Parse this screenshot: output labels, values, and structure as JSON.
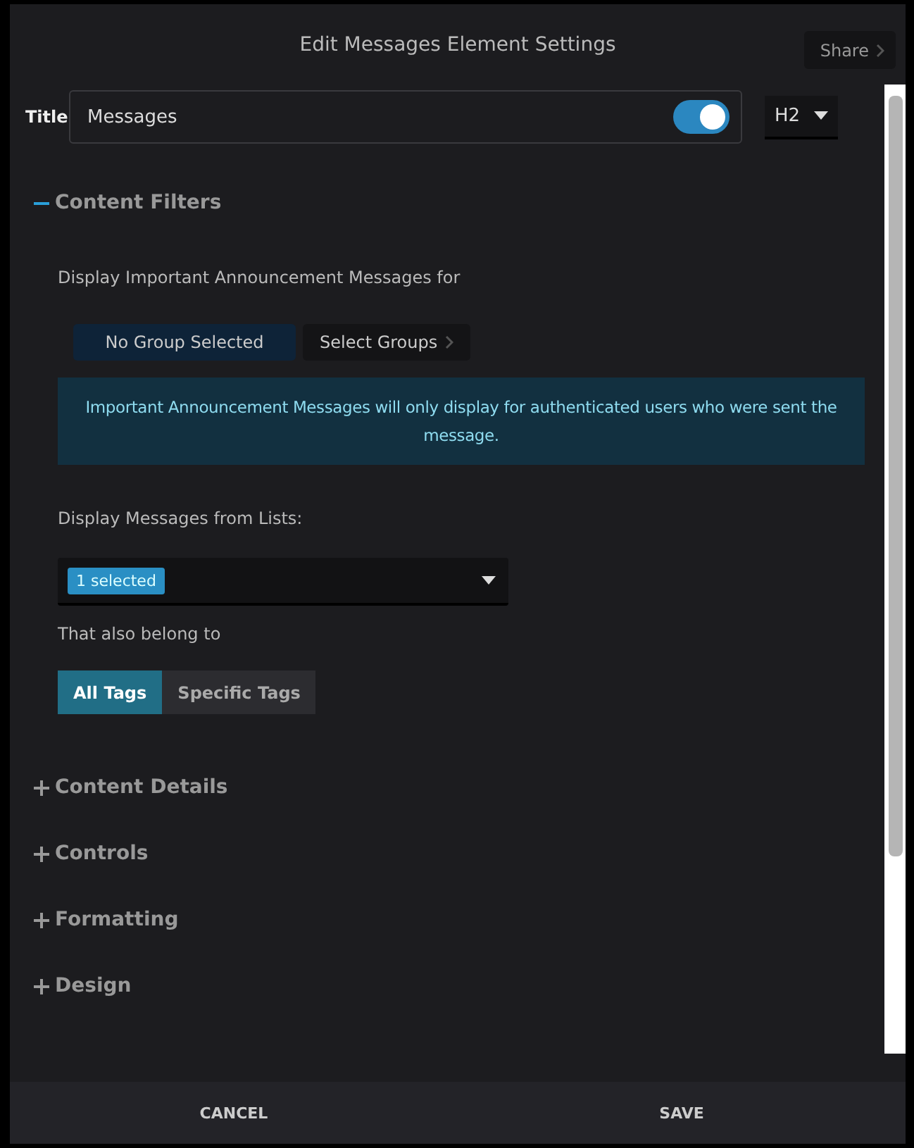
{
  "header": {
    "title": "Edit Messages Element Settings",
    "share_button": "Share"
  },
  "title_row": {
    "label": "Title",
    "value": "Messages",
    "toggle_on": true,
    "heading_level": "H2"
  },
  "sections": [
    {
      "title": "Content Filters",
      "expanded": true,
      "group_label": "Display Important Announcement Messages for",
      "group_buttons": [
        {
          "label": "No Group Selected",
          "selected": true
        },
        {
          "label": "Select Groups",
          "selected": false
        }
      ],
      "notice": "Important Announcement Messages will only display for authenticated users who were sent the message.",
      "lists_label": "Display Messages from Lists:",
      "lists_chip": "1 selected",
      "tags_label": "That also belong to",
      "tag_options": [
        {
          "label": "All Tags",
          "selected": true
        },
        {
          "label": "Specific Tags",
          "selected": false
        }
      ]
    },
    {
      "title": "Content Details",
      "expanded": false
    },
    {
      "title": "Controls",
      "expanded": false
    },
    {
      "title": "Formatting",
      "expanded": false
    },
    {
      "title": "Design",
      "expanded": false
    }
  ],
  "footer": {
    "cancel": "CANCEL",
    "save": "SAVE"
  }
}
